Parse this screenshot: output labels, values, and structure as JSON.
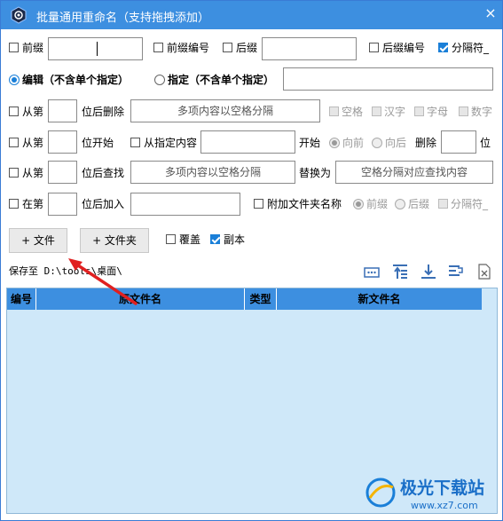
{
  "window": {
    "title": "批量通用重命名（支持拖拽添加）",
    "close_glyph": "×"
  },
  "row1": {
    "prefix_label": "前缀",
    "prefix_value": "",
    "prefix_number_label": "前缀编号",
    "suffix_label": "后缀",
    "suffix_value": "",
    "suffix_number_label": "后缀编号",
    "separator_label": "分隔符_"
  },
  "row2": {
    "edit_label": "编辑（不含单个指定）",
    "specify_label": "指定（不含单个指定）",
    "specify_value": ""
  },
  "row3": {
    "from_label": "从第",
    "after_delete_label": "位后删除",
    "delete_placeholder": "多项内容以空格分隔",
    "space_label": "空格",
    "hanzi_label": "汉字",
    "letter_label": "字母",
    "digit_label": "数字"
  },
  "row4": {
    "from_label": "从第",
    "start_label": "位开始",
    "from_content_label": "从指定内容",
    "start2_label": "开始",
    "forward_label": "向前",
    "backward_label": "向后",
    "delete_label": "删除",
    "unit_label": "位"
  },
  "row5": {
    "from_label": "从第",
    "after_find_label": "位后查找",
    "find_placeholder": "多项内容以空格分隔",
    "replace_label": "替换为",
    "replace_placeholder": "空格分隔对应查找内容"
  },
  "row6": {
    "at_label": "在第",
    "after_add_label": "位后加入",
    "folder_name_label": "附加文件夹名称",
    "prefix_label": "前缀",
    "suffix_label": "后缀",
    "separator_label": "分隔符_"
  },
  "actions": {
    "add_file_label": "+ 文件",
    "add_folder_label": "+ 文件夹",
    "overwrite_label": "覆盖",
    "copy_label": "副本"
  },
  "save": {
    "label": "保存至 D:\\tools\\桌面\\"
  },
  "table": {
    "columns": [
      "编号",
      "原文件名",
      "类型",
      "新文件名"
    ]
  },
  "watermark": {
    "line1": "极光下载站",
    "line2": "www.xz7.com"
  },
  "colors": {
    "title_bar": "#3d8fe0",
    "accent": "#1a7fd8",
    "grid_bg": "#cfe8f9",
    "arrow": "#e02020"
  }
}
